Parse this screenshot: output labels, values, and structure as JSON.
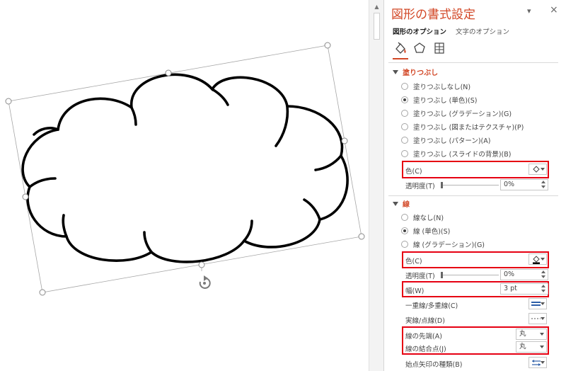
{
  "pane": {
    "title": "図形の書式設定",
    "tabs": [
      "図形のオプション",
      "文字のオプション"
    ],
    "active_tab": 0,
    "icons": [
      "fill-line-icon",
      "effects-icon",
      "size-properties-icon"
    ]
  },
  "fill": {
    "header": "塗りつぶし",
    "options": [
      "塗りつぶしなし(N)",
      "塗りつぶし (単色)(S)",
      "塗りつぶし (グラデーション)(G)",
      "塗りつぶし (図またはテクスチャ)(P)",
      "塗りつぶし (パターン)(A)",
      "塗りつぶし (スライドの背景)(B)"
    ],
    "selected_index": 1,
    "color_label": "色(C)",
    "transparency_label": "透明度(T)",
    "transparency_value": "0%",
    "color": "#ffffff"
  },
  "line": {
    "header": "線",
    "options": [
      "線なし(N)",
      "線 (単色)(S)",
      "線 (グラデーション)(G)"
    ],
    "selected_index": 1,
    "color_label": "色(C)",
    "transparency_label": "透明度(T)",
    "transparency_value": "0%",
    "width_label": "幅(W)",
    "width_value": "3 pt",
    "compound_label": "一重線/多重線(C)",
    "dash_label": "実線/点線(D)",
    "cap_label": "線の先端(A)",
    "cap_value": "丸",
    "join_label": "線の結合点(J)",
    "join_value": "丸",
    "arrow_label": "始点矢印の種類(B)",
    "color": "#000000"
  },
  "colors": {
    "accent": "#d24726",
    "highlight": "#e60012",
    "shape_outline": "#000000",
    "shape_fill": "#ffffff"
  },
  "controls": {
    "close_glyph": "×",
    "menu_glyph": "▾"
  }
}
